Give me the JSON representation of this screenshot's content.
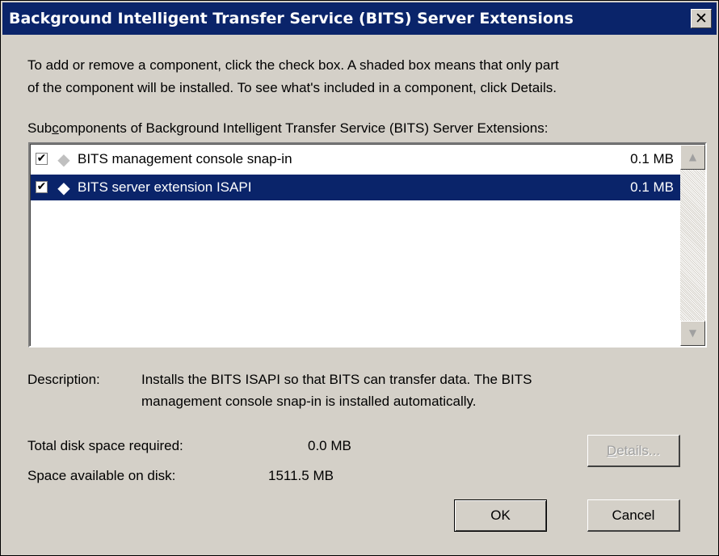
{
  "window": {
    "title": "Background Intelligent Transfer Service (BITS) Server Extensions",
    "close_glyph": "✕"
  },
  "instructions": {
    "line1": "To add or remove a component, click the check box. A shaded box means that only part",
    "line2": "of the component will be installed. To see what's included in a component, click Details."
  },
  "subcomponents": {
    "label_prefix": "Sub",
    "label_accel": "c",
    "label_rest": "omponents of Background Intelligent Transfer Service (BITS) Server Extensions:",
    "items": [
      {
        "label": "BITS management console snap-in",
        "size": "0.1 MB",
        "checked": true,
        "selected": false,
        "check_glyph": "✔",
        "icon": "component-diamond-icon",
        "icon_glyph": "◆"
      },
      {
        "label": "BITS server extension ISAPI",
        "size": "0.1 MB",
        "checked": true,
        "selected": true,
        "check_glyph": "✔",
        "icon": "component-diamond-icon",
        "icon_glyph": "◆"
      }
    ]
  },
  "scrollbar": {
    "up_glyph": "▲",
    "down_glyph": "▼"
  },
  "description": {
    "label": "Description:",
    "line1": "Installs the BITS ISAPI so that BITS can transfer data. The BITS",
    "line2": "management console snap-in is installed automatically."
  },
  "disk": {
    "required_label": "Total disk space required:",
    "required_value": "0.0 MB",
    "available_label": "Space available on disk:",
    "available_value": "1511.5 MB"
  },
  "buttons": {
    "details_accel": "D",
    "details_rest": "etails...",
    "ok": "OK",
    "cancel": "Cancel"
  },
  "colors": {
    "titlebar": "#0a246a",
    "face": "#d4d0c8",
    "selection": "#0a246a"
  }
}
